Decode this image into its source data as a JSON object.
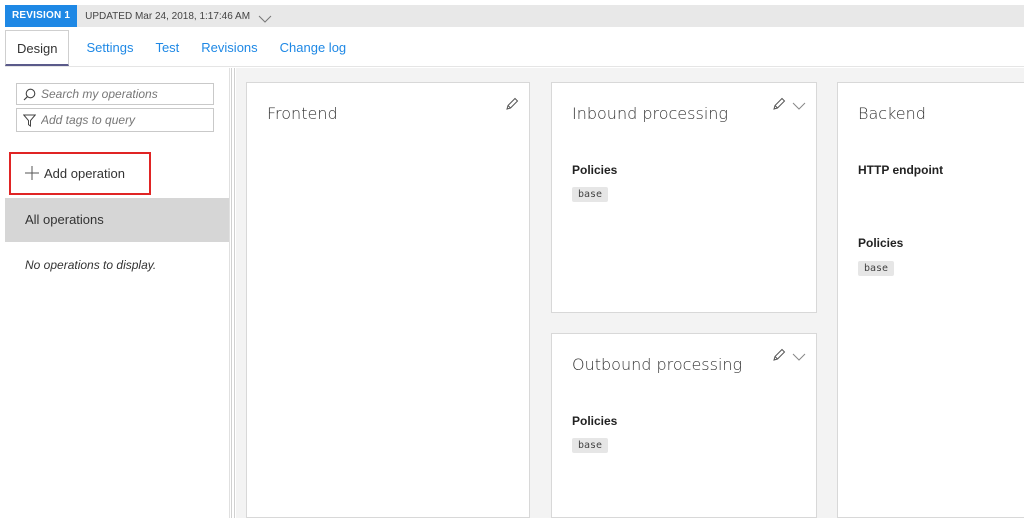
{
  "revision": {
    "badge": "REVISION 1",
    "updated": "UPDATED Mar 24, 2018, 1:17:46 AM"
  },
  "tabs": [
    {
      "label": "Design",
      "active": true
    },
    {
      "label": "Settings",
      "active": false
    },
    {
      "label": "Test",
      "active": false
    },
    {
      "label": "Revisions",
      "active": false
    },
    {
      "label": "Change log",
      "active": false
    }
  ],
  "sidebar": {
    "search_placeholder": "Search my operations",
    "tags_placeholder": "Add tags to query",
    "add_operation_label": "Add operation",
    "all_operations_label": "All operations",
    "empty_message": "No operations to display."
  },
  "cards": {
    "frontend": {
      "title": "Frontend"
    },
    "inbound": {
      "title": "Inbound processing",
      "policies_label": "Policies",
      "policy_badge": "base"
    },
    "outbound": {
      "title": "Outbound processing",
      "policies_label": "Policies",
      "policy_badge": "base"
    },
    "backend": {
      "title": "Backend",
      "endpoint_label": "HTTP endpoint",
      "policies_label": "Policies",
      "policy_badge": "base"
    }
  },
  "colors": {
    "accent": "#1e88e5",
    "highlight_border": "#e02424",
    "selected_row": "#d6d6d6",
    "canvas_bg": "#f3f3f3"
  },
  "icons": [
    "chevron-down-icon",
    "search-icon",
    "filter-icon",
    "plus-icon",
    "pencil-icon"
  ]
}
